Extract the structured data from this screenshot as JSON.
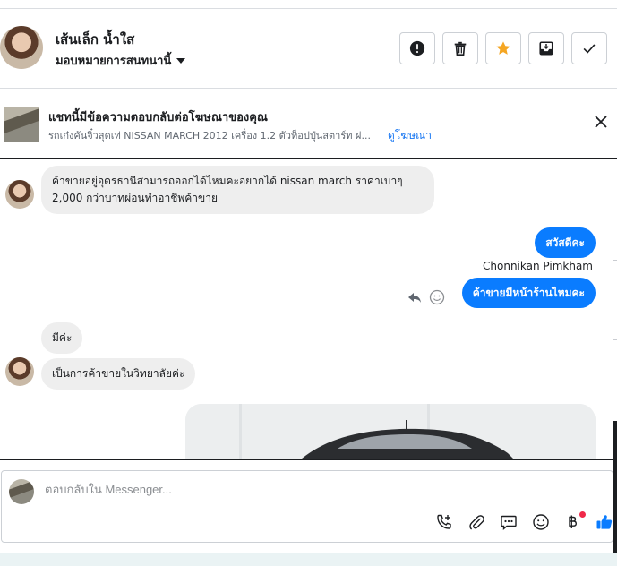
{
  "header": {
    "contact_name": "เส้นเล็ก น้ำใส",
    "assign_label": "มอบหมายการสนทนานี้",
    "actions": [
      {
        "name": "alert-icon"
      },
      {
        "name": "trash-icon"
      },
      {
        "name": "star-icon",
        "color": "#f5a623"
      },
      {
        "name": "archive-inbox-icon"
      },
      {
        "name": "check-icon"
      }
    ]
  },
  "ad_banner": {
    "title": "แชทนี้มีข้อความตอบกลับต่อโฆษณาของคุณ",
    "subtitle": "รถเก๋งคันจิ๋วสุดเท่ NISSAN MARCH 2012 เครื่อง 1.2 ตัวท็อปปุ่นสตาร์ท ผ่...",
    "link": "ดูโฆษณา"
  },
  "messages": {
    "m1": "ค้าขายอยู่อุดรธานีสามารถออกได้ไหมคะอยากได้ nissan march ราคาเบาๆ 2,000 กว่าบาทผ่อนทำอาชีพค้าขาย",
    "m2": "สวัสดีคะ",
    "sender": "Chonnikan Pimkham",
    "m3": "ค้าขายมีหน้าร้านไหมคะ",
    "m4": "มีค่ะ",
    "m5": "เป็นการค้าขายในวิทยาลัยค่ะ"
  },
  "composer": {
    "placeholder": "ตอบกลับใน Messenger..."
  },
  "colors": {
    "accent": "#0a7cff",
    "incoming_bubble": "#eeeeee",
    "link": "#1877f2"
  }
}
